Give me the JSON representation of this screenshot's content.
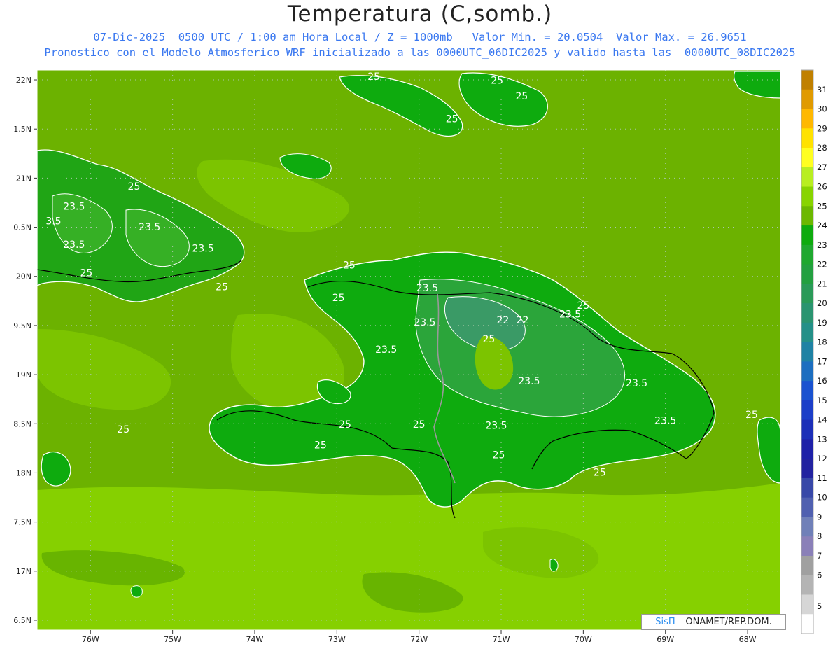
{
  "header": {
    "title": "Temperatura (C,somb.)",
    "line1": "07-Dic-2025  0500 UTC / 1:00 am Hora Local / Z = 1000mb   Valor Min. = 20.0504  Valor Max. = 26.9651",
    "line2": "Pronostico con el Modelo Atmosferico WRF inicializado a las 0000UTC_06DIC2025 y valido hasta las  0000UTC_08DIC2025"
  },
  "credit": {
    "brand": "SisΠ",
    "text": " – ONAMET/REP.DOM."
  },
  "map": {
    "lat_labels": [
      "22N",
      "1.5N",
      "21N",
      "0.5N",
      "20N",
      "9.5N",
      "19N",
      "8.5N",
      "18N",
      "7.5N",
      "17N",
      "6.5N"
    ],
    "lat_values": [
      22,
      21.5,
      21,
      20.5,
      20,
      19.5,
      19,
      18.5,
      18,
      17.5,
      17,
      16.5
    ],
    "lon_labels": [
      "76W",
      "75W",
      "74W",
      "73W",
      "72W",
      "71W",
      "70W",
      "69W",
      "68W"
    ],
    "lon_values": [
      -76,
      -75,
      -74,
      -73,
      -72,
      -71,
      -70,
      -69,
      -68
    ],
    "lon_range": [
      -76.65,
      -67.6
    ],
    "lat_range": [
      16.4,
      22.1
    ],
    "contour_labels": [
      {
        "text": "25",
        "lon": -72.55,
        "lat": 22.0
      },
      {
        "text": "25",
        "lon": -71.05,
        "lat": 21.96
      },
      {
        "text": "25",
        "lon": -70.75,
        "lat": 21.8
      },
      {
        "text": "25",
        "lon": -71.6,
        "lat": 21.57
      },
      {
        "text": "25",
        "lon": -75.47,
        "lat": 20.88
      },
      {
        "text": "23.5",
        "lon": -76.2,
        "lat": 20.68
      },
      {
        "text": "3.5",
        "lon": -76.45,
        "lat": 20.53
      },
      {
        "text": "23.5",
        "lon": -75.28,
        "lat": 20.47
      },
      {
        "text": "23.5",
        "lon": -76.2,
        "lat": 20.29
      },
      {
        "text": "23.5",
        "lon": -74.63,
        "lat": 20.25
      },
      {
        "text": "25",
        "lon": -76.05,
        "lat": 20.0
      },
      {
        "text": "25",
        "lon": -72.85,
        "lat": 20.08
      },
      {
        "text": "25",
        "lon": -74.4,
        "lat": 19.86
      },
      {
        "text": "25",
        "lon": -72.98,
        "lat": 19.75
      },
      {
        "text": "23.5",
        "lon": -71.9,
        "lat": 19.85
      },
      {
        "text": "25",
        "lon": -70.0,
        "lat": 19.67
      },
      {
        "text": "22",
        "lon": -70.98,
        "lat": 19.52
      },
      {
        "text": "22",
        "lon": -70.74,
        "lat": 19.52
      },
      {
        "text": "23.5",
        "lon": -71.93,
        "lat": 19.5
      },
      {
        "text": "23.5",
        "lon": -70.16,
        "lat": 19.58
      },
      {
        "text": "25",
        "lon": -71.15,
        "lat": 19.33
      },
      {
        "text": "23.5",
        "lon": -72.4,
        "lat": 19.22
      },
      {
        "text": "23.5",
        "lon": -70.66,
        "lat": 18.9
      },
      {
        "text": "23.5",
        "lon": -69.35,
        "lat": 18.88
      },
      {
        "text": "25",
        "lon": -67.95,
        "lat": 18.56
      },
      {
        "text": "23.5",
        "lon": -69.0,
        "lat": 18.5
      },
      {
        "text": "25",
        "lon": -72.9,
        "lat": 18.46
      },
      {
        "text": "25",
        "lon": -72.0,
        "lat": 18.46
      },
      {
        "text": "23.5",
        "lon": -71.06,
        "lat": 18.45
      },
      {
        "text": "25",
        "lon": -75.6,
        "lat": 18.41
      },
      {
        "text": "25",
        "lon": -73.2,
        "lat": 18.25
      },
      {
        "text": "25",
        "lon": -71.03,
        "lat": 18.15
      },
      {
        "text": "25",
        "lon": -69.8,
        "lat": 17.97
      }
    ]
  },
  "legend": {
    "levels": [
      "31",
      "30",
      "29",
      "28",
      "27",
      "26",
      "25",
      "24",
      "23",
      "22",
      "21",
      "20",
      "19",
      "18",
      "17",
      "16",
      "15",
      "14",
      "13",
      "12",
      "11",
      "10",
      "9",
      "8",
      "7",
      "6",
      "5"
    ],
    "colors": [
      "#c08000",
      "#e09a00",
      "#ffb800",
      "#ffe200",
      "#ffff20",
      "#b8ee20",
      "#88d400",
      "#6cb800",
      "#0eab0e",
      "#1fa82f",
      "#23a040",
      "#2a9a58",
      "#2a9470",
      "#249088",
      "#1f82a4",
      "#1d6ec0",
      "#1a52d0",
      "#1c3ec8",
      "#1c2fb8",
      "#1e20a8",
      "#2222a0",
      "#3848a8",
      "#5060b0",
      "#7080b8",
      "#8a80b8",
      "#a0a0a0",
      "#b4b4b4",
      "#d6d6d6",
      "#ffffff"
    ]
  }
}
